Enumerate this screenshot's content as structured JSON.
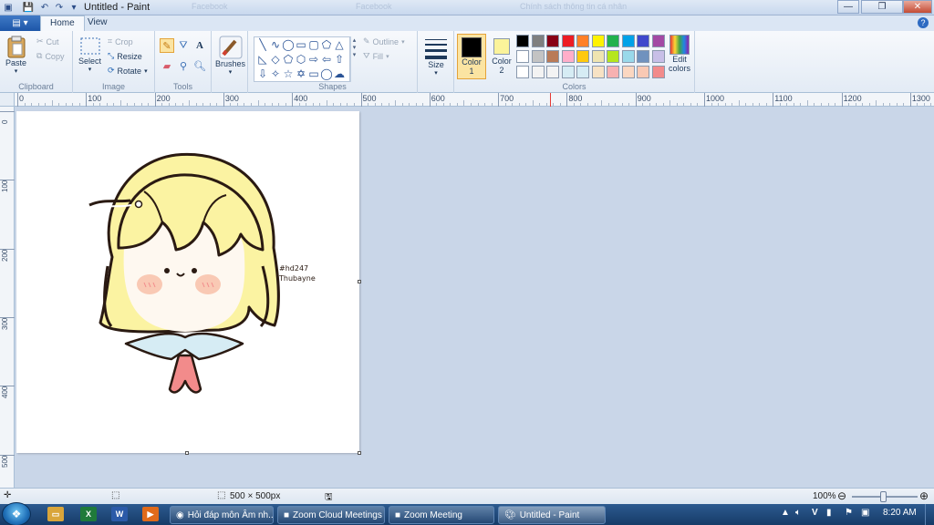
{
  "window": {
    "title": "Untitled - Paint"
  },
  "background_tabs": [
    "Facebook",
    "Facebook",
    "Chính sách thông tin cá nhân"
  ],
  "tabs": {
    "home": "Home",
    "view": "View"
  },
  "clipboard": {
    "paste": "Paste",
    "cut": "Cut",
    "copy": "Copy",
    "label": "Clipboard"
  },
  "image": {
    "select": "Select",
    "crop": "Crop",
    "resize": "Resize",
    "rotate": "Rotate",
    "label": "Image"
  },
  "tools": {
    "label": "Tools"
  },
  "brushes": {
    "label": "Brushes"
  },
  "shapes": {
    "outline": "Outline",
    "fill": "Fill",
    "label": "Shapes"
  },
  "size": {
    "label": "Size"
  },
  "colors": {
    "color1_label": "Color",
    "color1_num": "1",
    "color1_value": "#000000",
    "color2_label": "Color",
    "color2_num": "2",
    "color2_value": "#fbf39a",
    "edit_label": "Edit",
    "edit_label2": "colors",
    "label": "Colors",
    "palette_row1": [
      "#000000",
      "#7f7f7f",
      "#880015",
      "#ed1c24",
      "#ff7f27",
      "#fff200",
      "#22b14c",
      "#00a2e8",
      "#3f48cc",
      "#a349a4"
    ],
    "palette_row2": [
      "#ffffff",
      "#c3c3c3",
      "#b97a57",
      "#ffaec9",
      "#ffc90e",
      "#efe4b0",
      "#b5e61d",
      "#99d9ea",
      "#7092be",
      "#c8bfe7"
    ],
    "palette_row3": [
      "#ffffff",
      "#f3f3f3",
      "#f3f3f3",
      "#d6ecf4",
      "#d6ecf4",
      "#f7e2c4",
      "#f7b1b1",
      "#fbd7c1",
      "#f9c9b4",
      "#f28b8b"
    ]
  },
  "ruler": {
    "h_labels": [
      "0",
      "100",
      "200",
      "300",
      "400",
      "500",
      "600",
      "700",
      "800",
      "900",
      "1000",
      "1100",
      "1200",
      "1300"
    ],
    "v_labels": [
      "0",
      "100",
      "200",
      "300",
      "400",
      "500"
    ]
  },
  "canvas_text": {
    "line1": "#hd247",
    "line2": "Thubayne"
  },
  "status": {
    "size": "500 × 500px",
    "zoom": "100%"
  },
  "taskbar": {
    "tasks": [
      "Hỏi đáp môn Âm nh...",
      "Zoom Cloud Meetings",
      "Zoom Meeting",
      "Untitled - Paint"
    ],
    "time": "8:20 AM",
    "ime": "V"
  }
}
